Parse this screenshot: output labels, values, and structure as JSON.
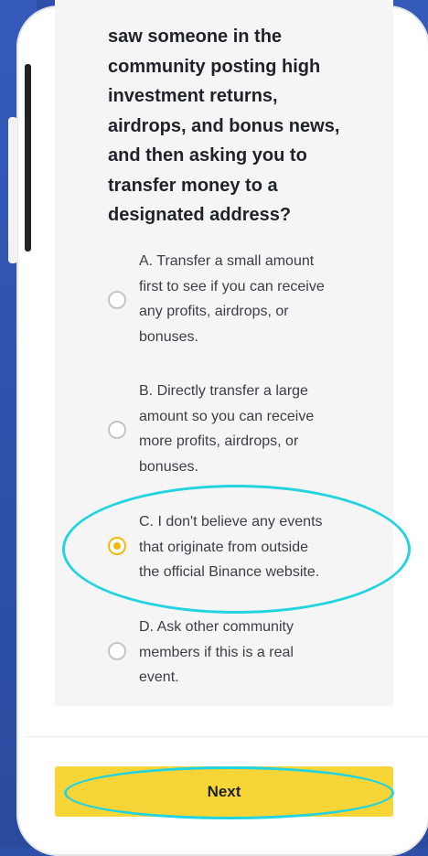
{
  "question": {
    "lines": [
      "saw someone in the",
      "community posting high",
      "investment returns,",
      "airdrops, and bonus news,",
      "and then asking you to",
      "transfer money to a",
      "designated address?"
    ]
  },
  "options": [
    {
      "lines": [
        "A. Transfer a small amount",
        "first to see if you can receive",
        "any profits, airdrops, or",
        "bonuses."
      ],
      "selected": false
    },
    {
      "lines": [
        "B. Directly transfer a large",
        "amount so you can receive",
        "more profits, airdrops, or",
        "bonuses."
      ],
      "selected": false
    },
    {
      "lines": [
        "C. I don't believe any events",
        "that originate from outside",
        "the official Binance website."
      ],
      "selected": true
    },
    {
      "lines": [
        "D. Ask other community",
        "members if this is a real",
        "event."
      ],
      "selected": false
    }
  ],
  "footer": {
    "next_label": "Next"
  },
  "colors": {
    "accent": "#f0b90b",
    "button": "#f7d537",
    "highlight": "#22d3e0"
  }
}
